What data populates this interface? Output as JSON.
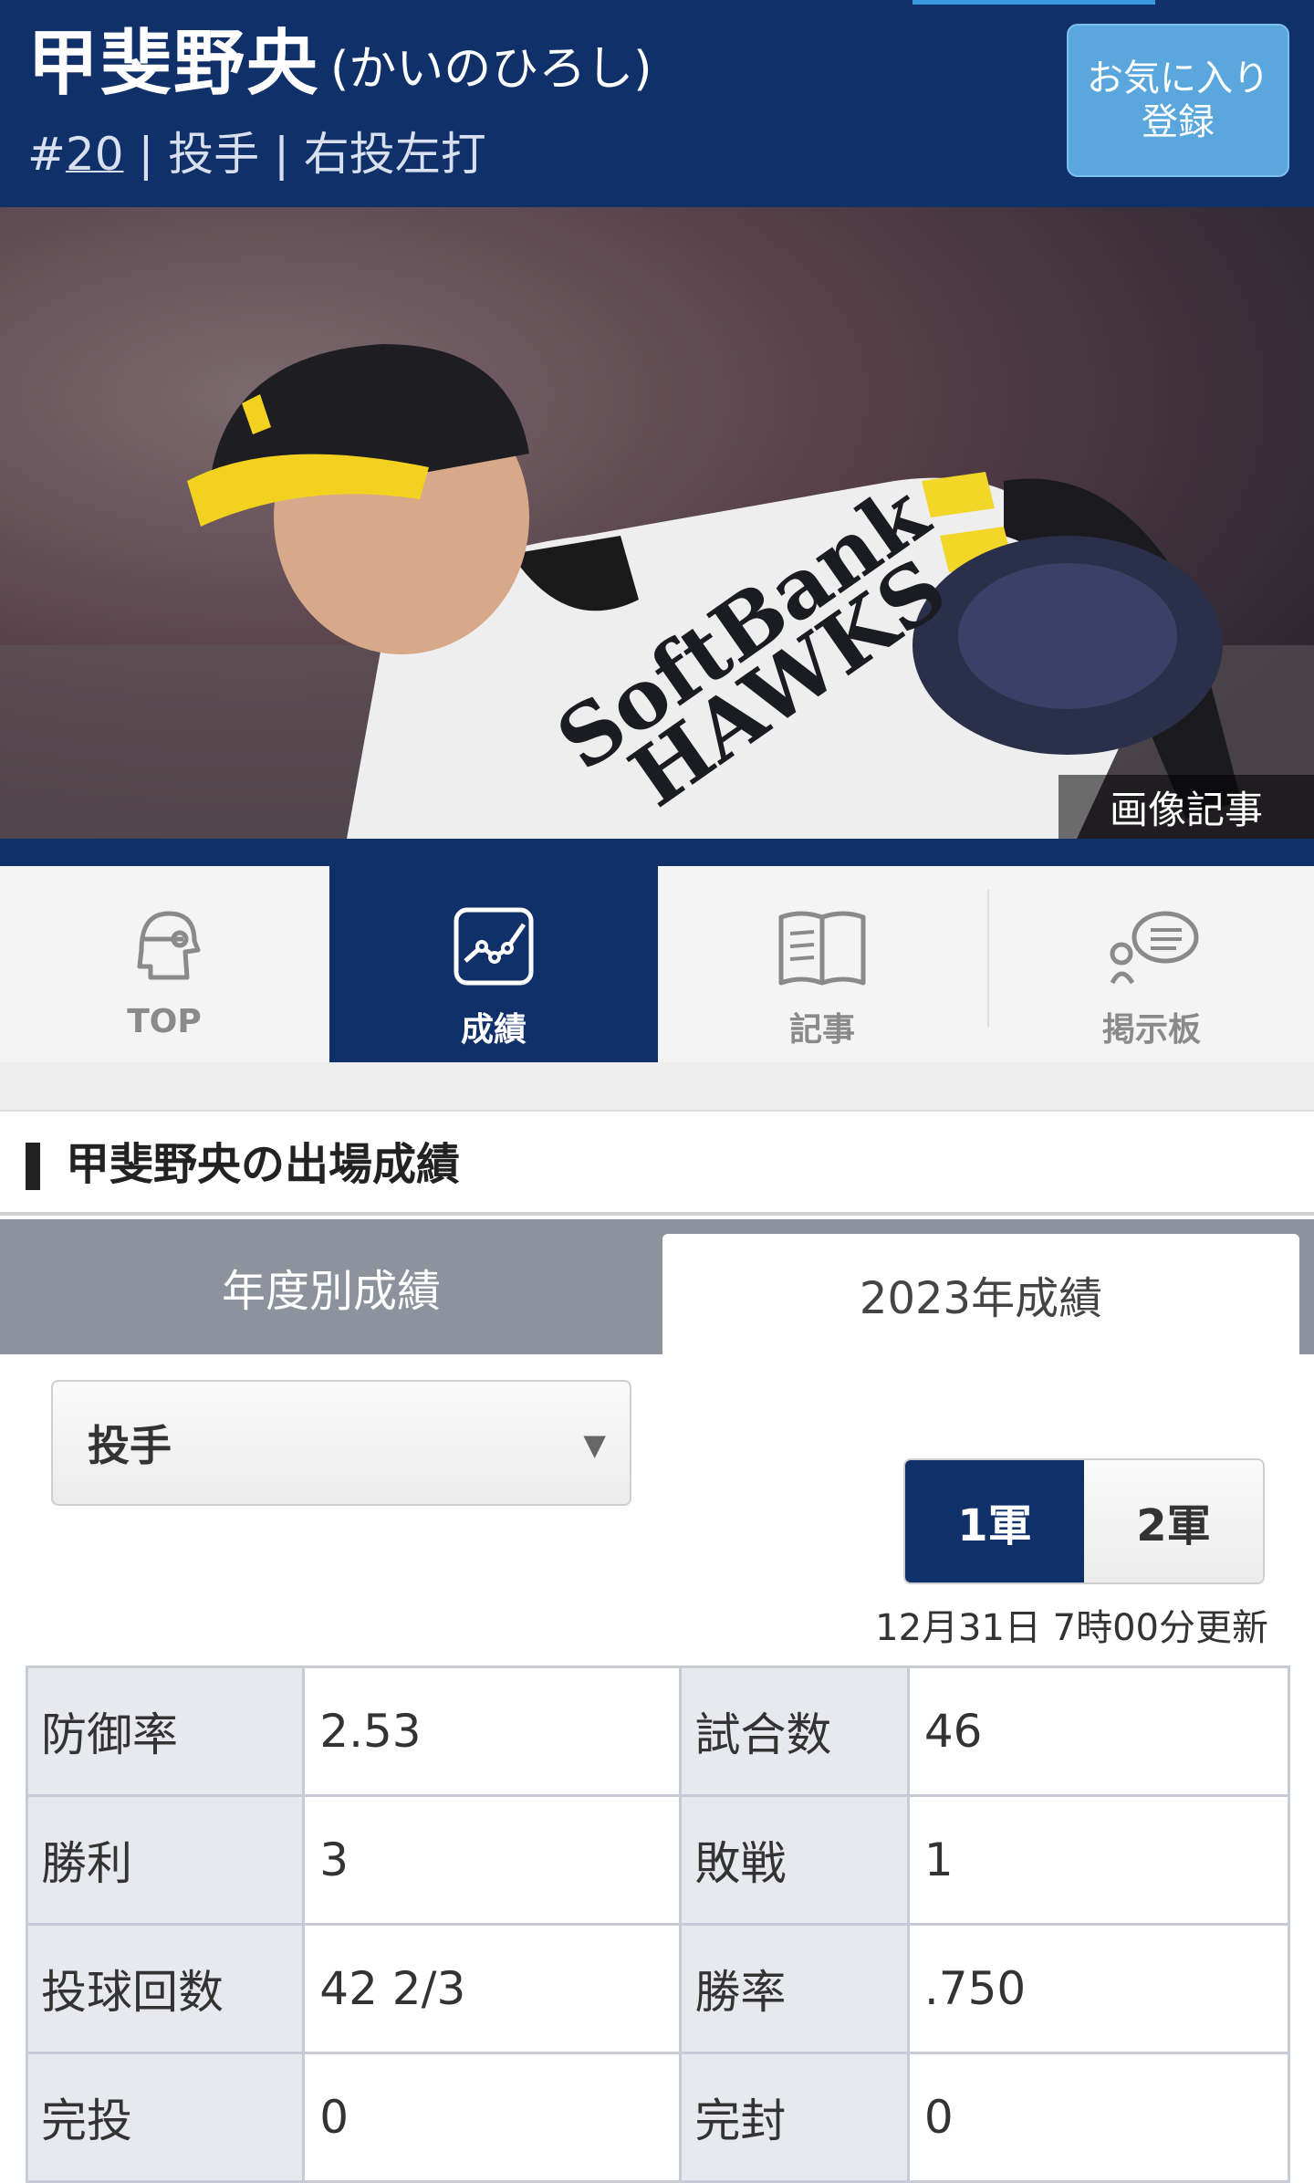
{
  "header": {
    "name": "甲斐野央",
    "kana": "(かいのひろし)",
    "number_prefix": "#",
    "number": "20",
    "meta_rest": "| 投手 | 右投左打",
    "favorite_line1": "お気に入り",
    "favorite_line2": "登録"
  },
  "hero": {
    "caption": "画像記事"
  },
  "tabs": [
    {
      "label": "TOP",
      "icon": "player-head-icon",
      "active": false
    },
    {
      "label": "成績",
      "icon": "chart-line-icon",
      "active": true
    },
    {
      "label": "記事",
      "icon": "book-icon",
      "active": false
    },
    {
      "label": "掲示板",
      "icon": "speech-bubble-icon",
      "active": false
    }
  ],
  "section": {
    "title": "甲斐野央の出場成績"
  },
  "year_tabs": {
    "left": "年度別成績",
    "right": "2023年成績"
  },
  "select": {
    "value": "投手",
    "arrow": "▼"
  },
  "army": {
    "first": "1軍",
    "second": "2軍"
  },
  "updated": "12月31日 7時00分更新",
  "stats": [
    {
      "label1": "防御率",
      "value1": "2.53",
      "label2": "試合数",
      "value2": "46"
    },
    {
      "label1": "勝利",
      "value1": "3",
      "label2": "敗戦",
      "value2": "1"
    },
    {
      "label1": "投球回数",
      "value1": "42 2/3",
      "label2": "勝率",
      "value2": ".750"
    },
    {
      "label1": "完投",
      "value1": "0",
      "label2": "完封",
      "value2": "0"
    }
  ],
  "colors": {
    "navy": "#10306a",
    "accent_blue": "#5aa7dd",
    "tab_gray": "#8c939c"
  }
}
